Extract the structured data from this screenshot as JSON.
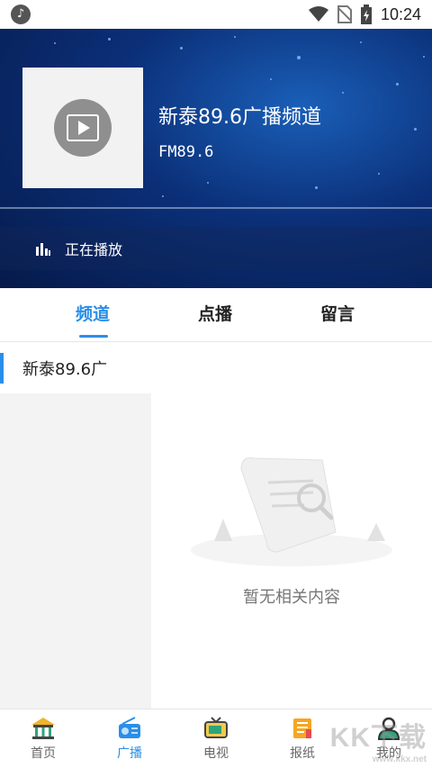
{
  "status_bar": {
    "time": "10:24",
    "icons": [
      "app-notification-icon",
      "wifi-icon",
      "no-sim-icon",
      "battery-charging-icon"
    ]
  },
  "header": {
    "channel_title": "新泰89.6广播频道",
    "frequency": "FM89.6",
    "playing_status": "正在播放",
    "cover_icon": "play-video-icon",
    "colors": {
      "bg_dark": "#061a4a",
      "bg_light": "#1a5fb8"
    }
  },
  "tabs": [
    {
      "label": "频道",
      "active": true
    },
    {
      "label": "点播",
      "active": false
    },
    {
      "label": "留言",
      "active": false
    }
  ],
  "channel_list": [
    {
      "label": "新泰89.6广",
      "active": true
    }
  ],
  "empty_state": {
    "text": "暂无相关内容"
  },
  "bottom_nav": [
    {
      "label": "首页",
      "icon": "home-building-icon",
      "active": false
    },
    {
      "label": "广播",
      "icon": "radio-icon",
      "active": true
    },
    {
      "label": "电视",
      "icon": "tv-icon",
      "active": false
    },
    {
      "label": "报纸",
      "icon": "newspaper-icon",
      "active": false
    },
    {
      "label": "我的",
      "icon": "user-icon",
      "active": false
    }
  ],
  "watermark": {
    "text": "KK下载",
    "subtext": "www.kkx.net"
  },
  "accent_color": "#2a8ee8"
}
